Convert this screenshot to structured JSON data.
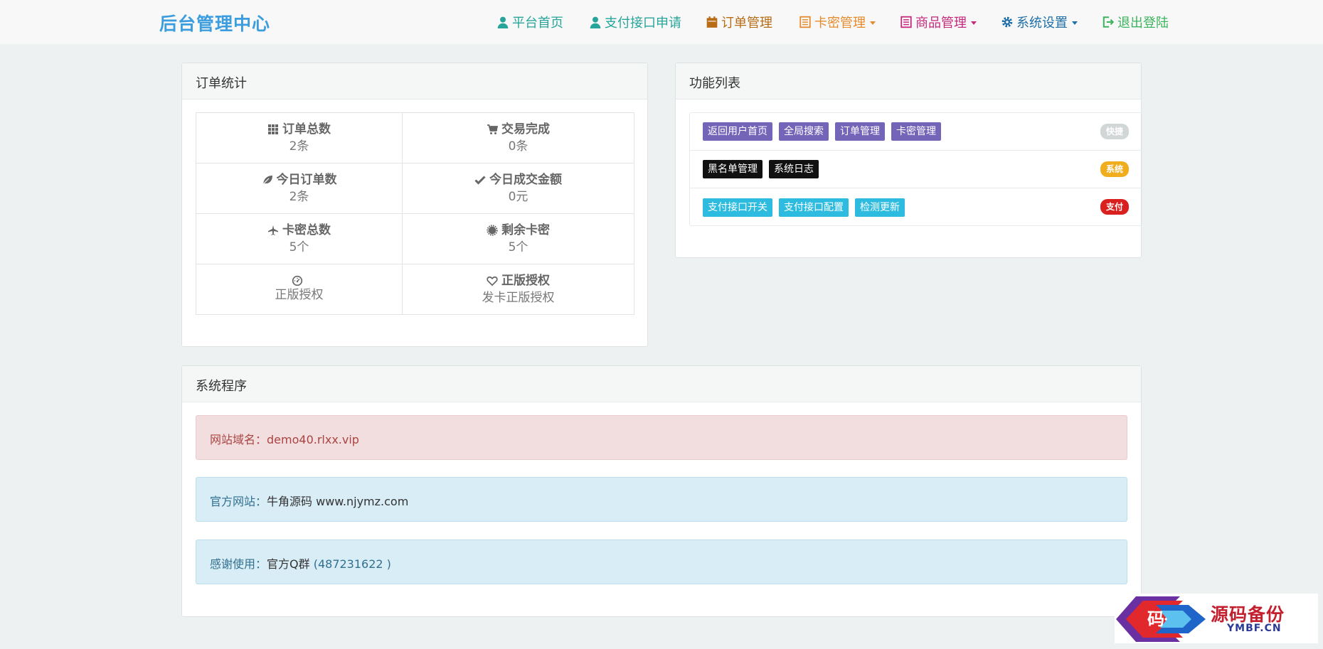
{
  "navbar": {
    "brand": "后台管理中心",
    "items": [
      {
        "label": "平台首页",
        "icon": "user-icon",
        "color": "#27a59b"
      },
      {
        "label": "支付接口申请",
        "icon": "user-icon",
        "color": "#27a59b"
      },
      {
        "label": "订单管理",
        "icon": "calendar-icon",
        "color": "#b76c15"
      },
      {
        "label": "卡密管理",
        "icon": "list-icon",
        "color": "#e58b2d"
      },
      {
        "label": "商品管理",
        "icon": "list-icon",
        "color": "#c4297e"
      },
      {
        "label": "系统设置",
        "icon": "gear-icon",
        "color": "#1f6fa8"
      },
      {
        "label": "退出登陆",
        "icon": "logout-icon",
        "color": "#3cb35d"
      }
    ]
  },
  "order_stats": {
    "title": "订单统计",
    "cells": [
      {
        "label": "订单总数",
        "value": "2条",
        "icon": "grid-icon"
      },
      {
        "label": "交易完成",
        "value": "0条",
        "icon": "cart-icon"
      },
      {
        "label": "今日订单数",
        "value": "2条",
        "icon": "leaf-icon"
      },
      {
        "label": "今日成交金额",
        "value": "0元",
        "icon": "check-icon"
      },
      {
        "label": "卡密总数",
        "value": "5个",
        "icon": "plane-icon"
      },
      {
        "label": "剩余卡密",
        "value": "5个",
        "icon": "certificate-icon"
      },
      {
        "label": "",
        "value": "正版授权",
        "icon": "dashboard-icon"
      },
      {
        "label": "正版授权",
        "value": "发卡正版授权",
        "icon": "heart-icon"
      }
    ]
  },
  "function_list": {
    "title": "功能列表",
    "rows": [
      {
        "buttons": [
          "返回用户首页",
          "全局搜索",
          "订单管理",
          "卡密管理"
        ],
        "badge": "快捷",
        "badge_color": "#d1d6d6"
      },
      {
        "buttons": [
          "黑名单管理",
          "系统日志"
        ],
        "badge": "系统",
        "badge_color": "#f0ad1e"
      },
      {
        "buttons": [
          "支付接口开关",
          "支付接口配置",
          "检测更新"
        ],
        "badge": "支付",
        "badge_color": "#d9201f"
      }
    ]
  },
  "system_program": {
    "title": "系统程序",
    "domain_label": "网站域名：",
    "domain_value": "demo40.rlxx.vip",
    "site_label": "官方网站：",
    "site_value": "牛角源码 www.njymz.com",
    "thanks_label": "感谢使用：",
    "thanks_value": "官方Q群",
    "thanks_qq": "(487231622 )"
  },
  "watermark": {
    "logo_char": "码",
    "title": "源码备份",
    "subtitle": "YMBF.CN"
  }
}
